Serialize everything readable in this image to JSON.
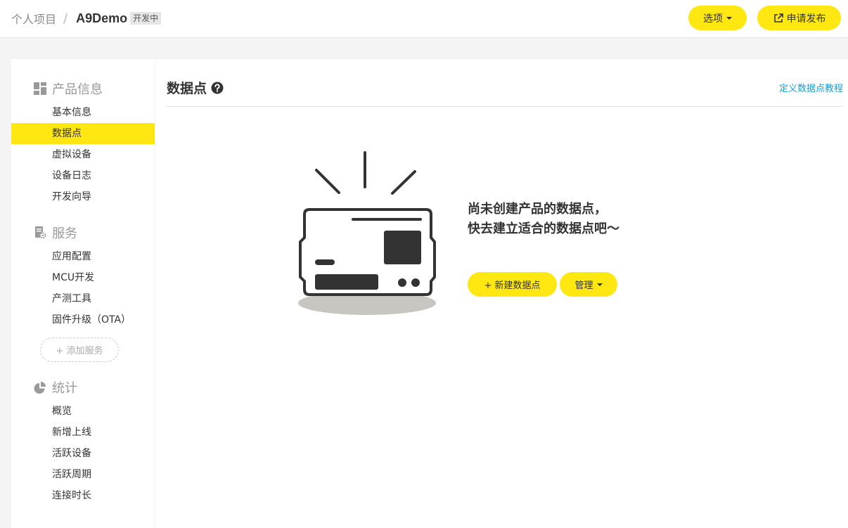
{
  "header": {
    "breadcrumb_root": "个人项目",
    "breadcrumb_sep": "/",
    "product_name": "A9Demo",
    "status_badge": "开发中",
    "options_label": "选项",
    "publish_label": "申请发布"
  },
  "sidebar": {
    "groups": [
      {
        "title": "产品信息",
        "icon": "dashboard-icon",
        "items": [
          "基本信息",
          "数据点",
          "虚拟设备",
          "设备日志",
          "开发向导"
        ]
      },
      {
        "title": "服务",
        "icon": "service-gear-icon",
        "items": [
          "应用配置",
          "MCU开发",
          "产测工具",
          "固件升级（OTA）"
        ]
      },
      {
        "title": "统计",
        "icon": "pie-chart-icon",
        "items": [
          "概览",
          "新增上线",
          "活跃设备",
          "活跃周期",
          "连接时长"
        ]
      }
    ],
    "active_item": "数据点",
    "add_service_label": "+ 添加服务"
  },
  "main": {
    "title": "数据点",
    "tutorial_link": "定义数据点教程",
    "empty_line1": "尚未创建产品的数据点，",
    "empty_line2": "快去建立适合的数据点吧～",
    "new_button": "+ 新建数据点",
    "manage_button": "管理"
  },
  "colors": {
    "accent": "#ffe812",
    "link": "#1a9ed8",
    "background": "#f4f4f4"
  }
}
